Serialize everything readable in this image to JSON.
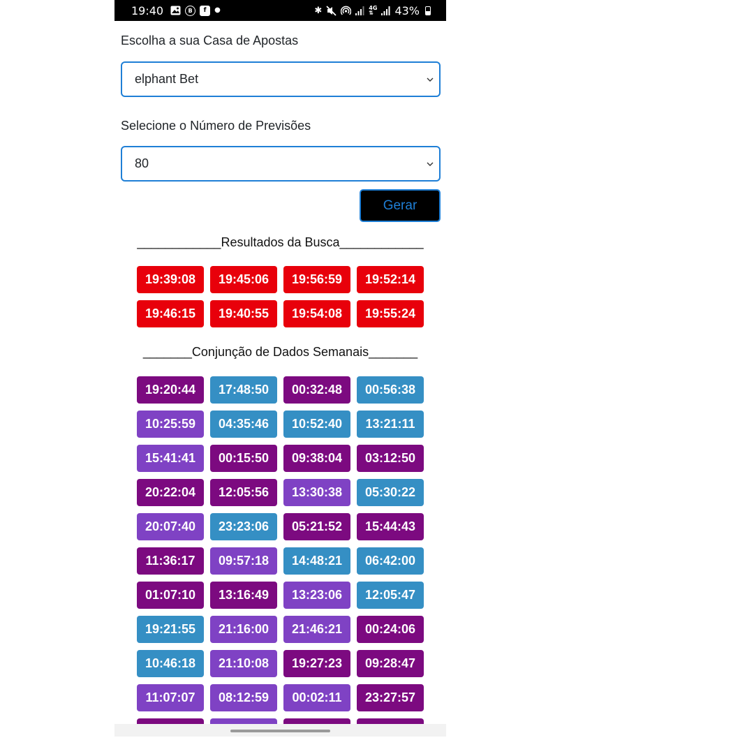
{
  "status_bar": {
    "time": "19:40",
    "battery_text": "43%",
    "left_icons": [
      "gallery-icon",
      "b-circle-icon",
      "facebook-icon",
      "dot-icon"
    ],
    "right_icons": [
      "bluetooth-icon",
      "mute-icon",
      "hotspot-icon",
      "signal-icon",
      "4g-signal-icon",
      "signal-icon-2",
      "battery-icon"
    ],
    "network_label": "4G"
  },
  "form": {
    "house_label": "Escolha a sua Casa de Apostas",
    "house_value": "elphant Bet",
    "predictions_label": "Selecione o Número de Previsões",
    "predictions_value": "80",
    "generate_button": "Gerar"
  },
  "results": {
    "title": "____________Resultados da Busca____________",
    "items": [
      {
        "time": "19:39:08",
        "color": "#e8000b"
      },
      {
        "time": "19:45:06",
        "color": "#e8000b"
      },
      {
        "time": "19:56:59",
        "color": "#e8000b"
      },
      {
        "time": "19:52:14",
        "color": "#e8000b"
      },
      {
        "time": "19:46:15",
        "color": "#e8000b"
      },
      {
        "time": "19:40:55",
        "color": "#e8000b"
      },
      {
        "time": "19:54:08",
        "color": "#e8000b"
      },
      {
        "time": "19:55:24",
        "color": "#e8000b"
      }
    ]
  },
  "weekly": {
    "title": "_______Conjunção de Dados Semanais_______",
    "colors": {
      "purple": "#7c0a80",
      "violet": "#7f42c4",
      "blue": "#358fc4"
    },
    "items": [
      {
        "time": "19:20:44",
        "color": "#7c0a80"
      },
      {
        "time": "17:48:50",
        "color": "#358fc4"
      },
      {
        "time": "00:32:48",
        "color": "#7c0a80"
      },
      {
        "time": "00:56:38",
        "color": "#358fc4"
      },
      {
        "time": "10:25:59",
        "color": "#7f42c4"
      },
      {
        "time": "04:35:46",
        "color": "#358fc4"
      },
      {
        "time": "10:52:40",
        "color": "#358fc4"
      },
      {
        "time": "13:21:11",
        "color": "#358fc4"
      },
      {
        "time": "15:41:41",
        "color": "#7f42c4"
      },
      {
        "time": "00:15:50",
        "color": "#7c0a80"
      },
      {
        "time": "09:38:04",
        "color": "#7c0a80"
      },
      {
        "time": "03:12:50",
        "color": "#7c0a80"
      },
      {
        "time": "20:22:04",
        "color": "#7c0a80"
      },
      {
        "time": "12:05:56",
        "color": "#7c0a80"
      },
      {
        "time": "13:30:38",
        "color": "#7f42c4"
      },
      {
        "time": "05:30:22",
        "color": "#358fc4"
      },
      {
        "time": "20:07:40",
        "color": "#7f42c4"
      },
      {
        "time": "23:23:06",
        "color": "#358fc4"
      },
      {
        "time": "05:21:52",
        "color": "#7c0a80"
      },
      {
        "time": "15:44:43",
        "color": "#7c0a80"
      },
      {
        "time": "11:36:17",
        "color": "#7c0a80"
      },
      {
        "time": "09:57:18",
        "color": "#7f42c4"
      },
      {
        "time": "14:48:21",
        "color": "#358fc4"
      },
      {
        "time": "06:42:00",
        "color": "#358fc4"
      },
      {
        "time": "01:07:10",
        "color": "#7c0a80"
      },
      {
        "time": "13:16:49",
        "color": "#7c0a80"
      },
      {
        "time": "13:23:06",
        "color": "#7f42c4"
      },
      {
        "time": "12:05:47",
        "color": "#358fc4"
      },
      {
        "time": "19:21:55",
        "color": "#358fc4"
      },
      {
        "time": "21:16:00",
        "color": "#7f42c4"
      },
      {
        "time": "21:46:21",
        "color": "#7f42c4"
      },
      {
        "time": "00:24:06",
        "color": "#7c0a80"
      },
      {
        "time": "10:46:18",
        "color": "#358fc4"
      },
      {
        "time": "21:10:08",
        "color": "#7f42c4"
      },
      {
        "time": "19:27:23",
        "color": "#7c0a80"
      },
      {
        "time": "09:28:47",
        "color": "#7c0a80"
      },
      {
        "time": "11:07:07",
        "color": "#7f42c4"
      },
      {
        "time": "08:12:59",
        "color": "#7f42c4"
      },
      {
        "time": "00:02:11",
        "color": "#7f42c4"
      },
      {
        "time": "23:27:57",
        "color": "#7c0a80"
      }
    ],
    "partial_row_colors": [
      "#7c0a80",
      "#7f42c4",
      "#7c0a80",
      "#7c0a80"
    ]
  }
}
